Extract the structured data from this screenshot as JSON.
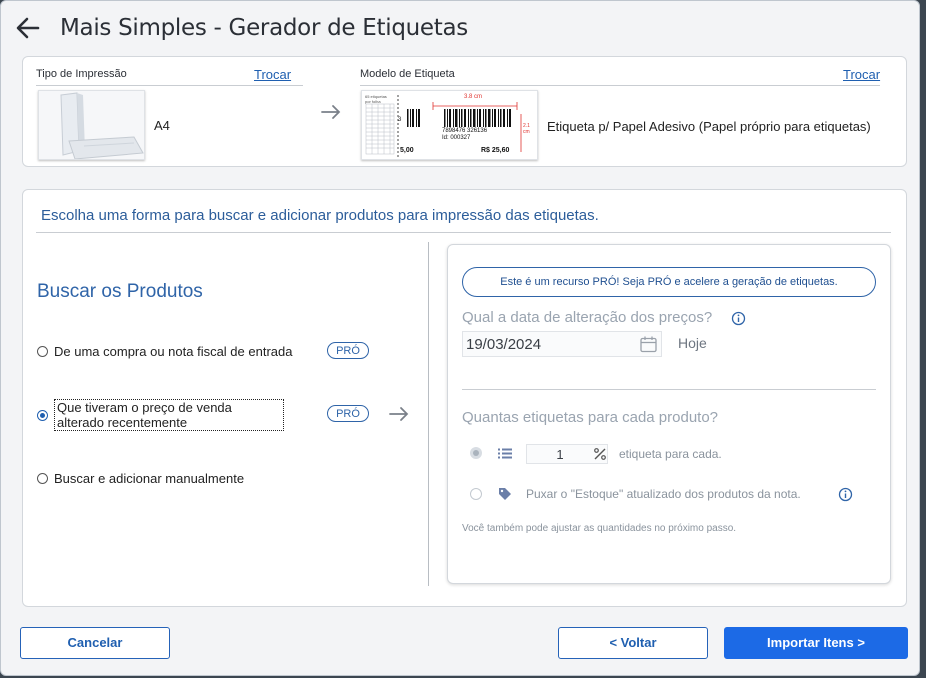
{
  "header": {
    "title": "Mais Simples - Gerador de Etiquetas"
  },
  "print": {
    "type_label": "Tipo de Impressão",
    "type_change": "Trocar",
    "type_value": "A4",
    "model_label": "Modelo de Etiqueta",
    "model_change": "Trocar",
    "model_value": "Etiqueta p/ Papel Adesivo (Papel próprio para etiquetas)",
    "preview": {
      "sheet_text": "65 etiquetas por folha",
      "width": "3.8 cm",
      "height": "2.1 cm",
      "barcode_number": "7898476 326136",
      "id_text": "Id: 000327",
      "price_small": "5,00",
      "price": "R$ 25,60",
      "digit": "3"
    }
  },
  "search": {
    "instruction": "Escolha uma forma para buscar e adicionar produtos para impressão das etiquetas.",
    "title": "Buscar os Produtos",
    "options": [
      {
        "label": "De uma compra ou nota fiscal de entrada",
        "badge": "PRÓ"
      },
      {
        "label": "Que tiveram o preço de venda alterado recentemente",
        "badge": "PRÓ"
      },
      {
        "label": "Buscar e adicionar manualmente"
      }
    ]
  },
  "pro_panel": {
    "banner": "Este é um recurso PRÓ! Seja PRÓ e acelere a geração de etiquetas.",
    "date_question": "Qual a data de alteração dos preços?",
    "date_value": "19/03/2024",
    "today_label": "Hoje",
    "qty_question": "Quantas etiquetas para cada produto?",
    "qty_value": "1",
    "qty_suffix": "etiqueta para cada.",
    "stock_label": "Puxar o \"Estoque\" atualizado dos produtos da nota.",
    "note": "Você também pode ajustar as quantidades no próximo passo."
  },
  "footer": {
    "cancel": "Cancelar",
    "back": "< Voltar",
    "import": "Importar Itens >"
  },
  "colors": {
    "accent": "#1c6ae6",
    "link": "#1f5fb0",
    "title_blue": "#2f64a8"
  }
}
